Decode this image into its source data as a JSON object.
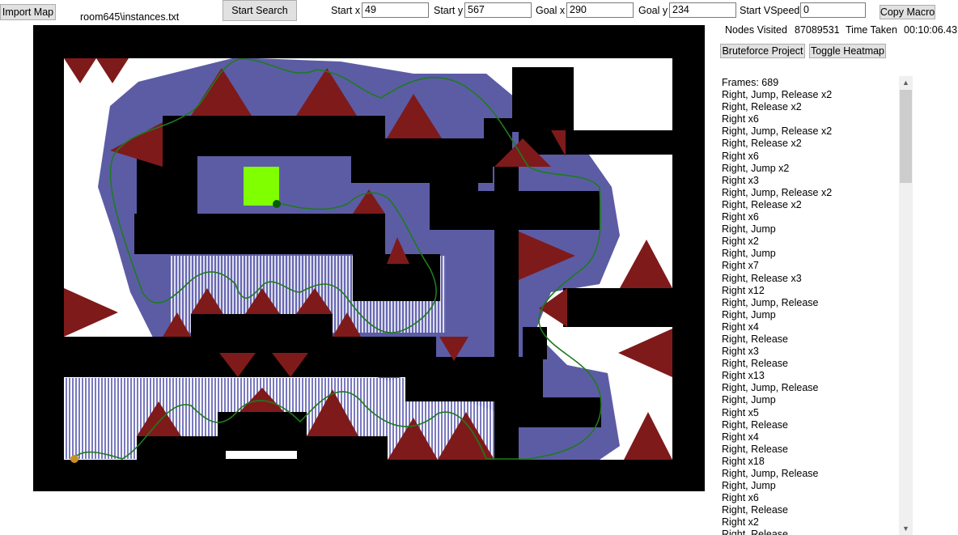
{
  "toolbar": {
    "import_label": "Import Map",
    "file_name": "room645\\instances.txt",
    "start_search_label": "Start Search",
    "start_x_label": "Start x",
    "start_x_value": "49",
    "start_y_label": "Start y",
    "start_y_value": "567",
    "goal_x_label": "Goal x",
    "goal_x_value": "290",
    "goal_y_label": "Goal y",
    "goal_y_value": "234",
    "start_vspeed_label": "Start VSpeed",
    "start_vspeed_value": "0",
    "copy_macro_label": "Copy Macro"
  },
  "stats": {
    "nodes_label": "Nodes Visited",
    "nodes_value": "87089531",
    "time_label": "Time Taken",
    "time_value": "00:10:06.43"
  },
  "actions": {
    "bruteforce_label": "Bruteforce Project",
    "heatmap_label": "Toggle Heatmap"
  },
  "map": {
    "colors": {
      "wall": "#000000",
      "open": "#ffffff",
      "spike": "#7f1a1a",
      "heat": "#4a4a9e",
      "path": "#1f7a1f",
      "goal": "#80ff00",
      "start_marker": "#c8901e"
    }
  },
  "macro": {
    "lines": [
      "Frames: 689",
      "Right, Jump, Release x2",
      "Right, Release x2",
      "Right x6",
      "Right, Jump, Release x2",
      "Right, Release x2",
      "Right x6",
      "Right, Jump x2",
      "Right x3",
      "Right, Jump, Release x2",
      "Right, Release x2",
      "Right x6",
      "Right, Jump",
      "Right x2",
      "Right, Jump",
      "Right x7",
      "Right, Release x3",
      "Right x12",
      "Right, Jump, Release",
      "Right, Jump",
      "Right x4",
      "Right, Release",
      "Right x3",
      "Right, Release",
      "Right x13",
      "Right, Jump, Release",
      "Right, Jump",
      "Right x5",
      "Right, Release",
      "Right x4",
      "Right, Release",
      "Right x18",
      "Right, Jump, Release",
      "Right, Jump",
      "Right x6",
      "Right, Release",
      "Right x2",
      "Right, Release"
    ]
  }
}
